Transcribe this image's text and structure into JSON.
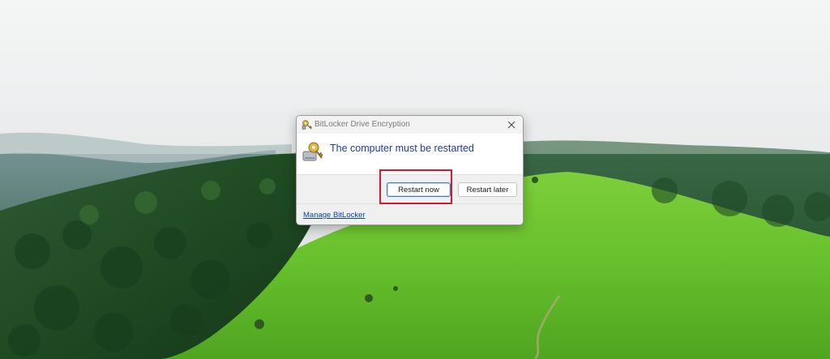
{
  "dialog": {
    "title": "BitLocker Drive Encryption",
    "heading": "The computer must be restarted",
    "close_icon": "close-icon",
    "app_icon": "bitlocker-key-icon"
  },
  "buttons": {
    "restart_now_label": "Restart now",
    "restart_later_label": "Restart later"
  },
  "footer": {
    "manage_link": "Manage BitLocker"
  },
  "colors": {
    "heading": "#1f3d95",
    "link": "#0645ad",
    "highlight": "#d6192b",
    "primary_border": "#3e78c4"
  }
}
